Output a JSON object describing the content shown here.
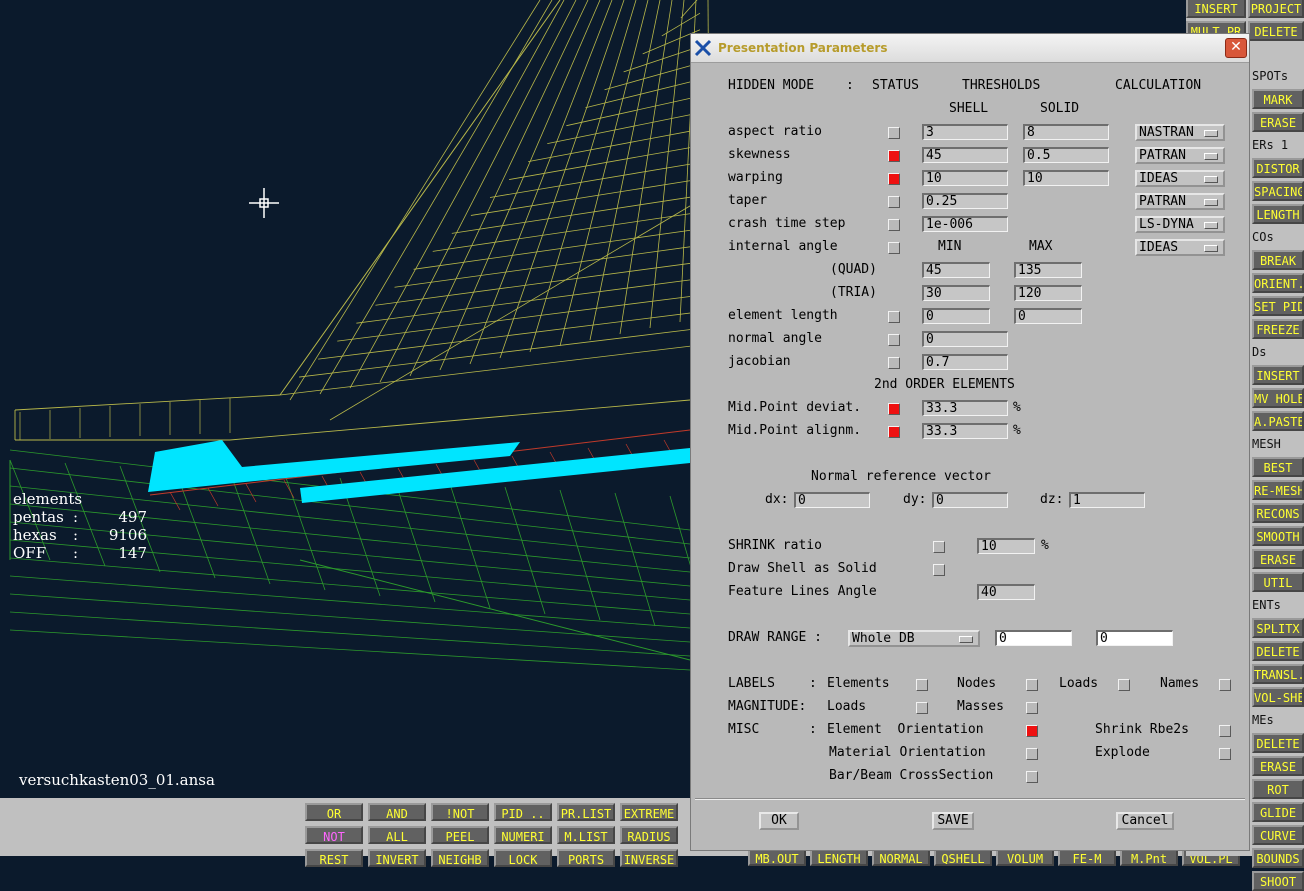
{
  "viewport": {
    "stats": {
      "title": "elements",
      "rows": [
        {
          "label": "pentas",
          "sep": ":",
          "value": "497"
        },
        {
          "label": "hexas",
          "sep": ":",
          "value": "9106"
        },
        {
          "label": "OFF",
          "sep": ":",
          "value": "147"
        }
      ]
    },
    "filename": "versuchkasten03_01.ansa"
  },
  "dialog": {
    "title": "Presentation Parameters",
    "close_glyph": "✕",
    "header": {
      "hidden_mode": "HIDDEN MODE",
      "colon": ":",
      "status": "STATUS",
      "thresholds": "THRESHOLDS",
      "calculation": "CALCULATION",
      "shell": "SHELL",
      "solid": "SOLID"
    },
    "rows": {
      "aspect_ratio": {
        "label": "aspect ratio",
        "checked": false,
        "shell": "3",
        "solid": "8",
        "calc": "NASTRAN"
      },
      "skewness": {
        "label": "skewness",
        "checked": true,
        "shell": "45",
        "solid": "0.5",
        "calc": "PATRAN"
      },
      "warping": {
        "label": "warping",
        "checked": true,
        "shell": "10",
        "solid": "10",
        "calc": "IDEAS"
      },
      "taper": {
        "label": "taper",
        "checked": false,
        "shell": "0.25",
        "calc": "PATRAN"
      },
      "crash_time_step": {
        "label": "crash time step",
        "checked": false,
        "shell": "1e-006",
        "calc": "LS-DYNA"
      },
      "internal_angle": {
        "label": "internal angle",
        "checked": false,
        "min_label": "MIN",
        "max_label": "MAX",
        "calc": "IDEAS"
      },
      "quad": {
        "label": "(QUAD)",
        "min": "45",
        "max": "135"
      },
      "tria": {
        "label": "(TRIA)",
        "min": "30",
        "max": "120"
      },
      "element_length": {
        "label": "element length",
        "checked": false,
        "min": "0",
        "max": "0"
      },
      "normal_angle": {
        "label": "normal angle",
        "checked": false,
        "value": "0"
      },
      "jacobian": {
        "label": "jacobian",
        "checked": false,
        "value": "0.7"
      }
    },
    "second_order": {
      "heading": "2nd ORDER ELEMENTS",
      "mid_deviat": {
        "label": "Mid.Point deviat.",
        "checked": true,
        "value": "33.3",
        "unit": "%"
      },
      "mid_alignm": {
        "label": "Mid.Point alignm.",
        "checked": true,
        "value": "33.3",
        "unit": "%"
      }
    },
    "normal_ref": {
      "heading": "Normal reference vector",
      "dx_label": "dx:",
      "dx": "0",
      "dy_label": "dy:",
      "dy": "0",
      "dz_label": "dz:",
      "dz": "1"
    },
    "shrink": {
      "label": "SHRINK ratio",
      "checked": false,
      "value": "10",
      "unit": "%"
    },
    "draw_shell": {
      "label": "Draw Shell as Solid",
      "checked": false
    },
    "feature_lines": {
      "label": "Feature Lines Angle",
      "value": "40"
    },
    "draw_range": {
      "label": "DRAW RANGE :",
      "selected": "Whole DB",
      "from": "0",
      "to": "0"
    },
    "labels": {
      "label": "LABELS",
      "colon": ":",
      "elements": "Elements",
      "nodes": "Nodes",
      "loads": "Loads",
      "names": "Names"
    },
    "magnitude": {
      "label": "MAGNITUDE:",
      "loads": "Loads",
      "masses": "Masses"
    },
    "misc": {
      "label": "MISC",
      "colon": ":",
      "element_orientation": "Element  Orientation",
      "element_orientation_checked": true,
      "shrink_rbe2s": "Shrink Rbe2s",
      "material_orientation": "Material Orientation",
      "explode": "Explode",
      "bar_beam": "Bar/Beam CrossSection"
    },
    "buttons": {
      "ok": "OK",
      "save": "SAVE",
      "cancel": "Cancel"
    }
  },
  "right_column": {
    "items": [
      {
        "type": "btn",
        "label": "INSERT"
      },
      {
        "type": "btn",
        "label": "PROJECT"
      },
      {
        "type": "btn",
        "label": "MULT.PR"
      },
      {
        "type": "btn",
        "label": "DELETE"
      },
      {
        "type": "lbl",
        "label": "SPOTs"
      },
      {
        "type": "btn",
        "label": "MARK"
      },
      {
        "type": "btn",
        "label": "ERASE"
      },
      {
        "type": "lbl",
        "label": "ERs 1"
      },
      {
        "type": "btn",
        "label": "DISTOR"
      },
      {
        "type": "btn",
        "label": "SPACING"
      },
      {
        "type": "btn",
        "label": "LENGTH"
      },
      {
        "type": "lbl",
        "label": "COs"
      },
      {
        "type": "btn",
        "label": "BREAK"
      },
      {
        "type": "btn",
        "label": "ORIENT."
      },
      {
        "type": "btn",
        "label": "SET PID"
      },
      {
        "type": "btn",
        "label": "FREEZE"
      },
      {
        "type": "lbl",
        "label": "Ds"
      },
      {
        "type": "btn",
        "label": "INSERT"
      },
      {
        "type": "btn",
        "label": "MV HOLE"
      },
      {
        "type": "btn",
        "label": "A.PASTE"
      },
      {
        "type": "lbl",
        "label": "MESH"
      },
      {
        "type": "btn",
        "label": "BEST"
      },
      {
        "type": "btn",
        "label": "RE-MESH"
      },
      {
        "type": "btn",
        "label": "RECONS"
      },
      {
        "type": "btn",
        "label": "SMOOTH"
      },
      {
        "type": "btn",
        "label": "ERASE"
      },
      {
        "type": "btn",
        "label": "UTIL"
      },
      {
        "type": "lbl",
        "label": "ENTs"
      },
      {
        "type": "btn",
        "label": "SPLITX"
      },
      {
        "type": "btn",
        "label": "DELETE"
      },
      {
        "type": "btn",
        "label": "TRANSL."
      },
      {
        "type": "btn",
        "label": "VOL-SHEL"
      },
      {
        "type": "lbl",
        "label": "MEs"
      },
      {
        "type": "btn",
        "label": "DELETE"
      },
      {
        "type": "btn",
        "label": "ERASE"
      },
      {
        "type": "btn",
        "label": "ROT"
      },
      {
        "type": "btn",
        "label": "GLIDE"
      },
      {
        "type": "btn",
        "label": "CURVE"
      },
      {
        "type": "btn",
        "label": "BOUNDS"
      },
      {
        "type": "btn",
        "label": "SHOOT"
      }
    ]
  },
  "bottom_bar": {
    "row1": [
      "OR",
      "AND",
      "!NOT",
      "PID ..",
      "PR.LIST",
      "EXTREME"
    ],
    "row2": [
      "NOT",
      "ALL",
      "PEEL",
      "NUMERI",
      "M.LIST",
      "RADIUS"
    ],
    "row3": [
      "REST",
      "INVERT",
      "NEIGHB",
      "LOCK",
      "PORTS",
      "INVERSE"
    ],
    "row4": [
      "MB.OUT",
      "LENGTH",
      "NORMAL",
      "QSHELL",
      "VOLUM",
      "FE-M",
      "M.Pnt",
      "VOL.PL"
    ]
  }
}
